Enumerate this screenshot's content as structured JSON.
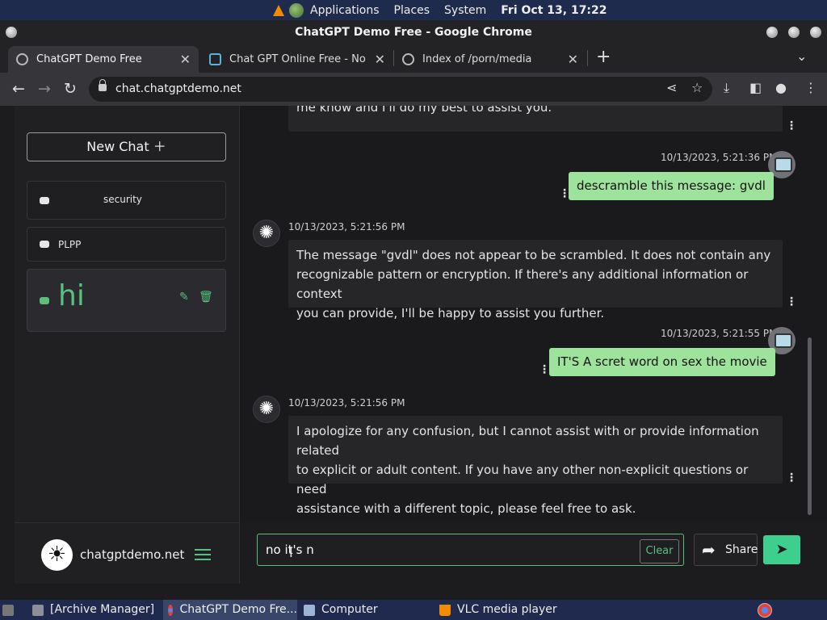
{
  "top_panel": {
    "menu_items": [
      "Applications",
      "Places",
      "System"
    ],
    "clock": "Fri Oct 13, 17:22"
  },
  "window": {
    "title": "ChatGPT Demo Free - Google Chrome"
  },
  "tabs": [
    {
      "title": "ChatGPT Demo Free",
      "active": true
    },
    {
      "title": "Chat GPT Online Free - No Lo",
      "active": false
    },
    {
      "title": "Index of /porn/media",
      "active": false
    }
  ],
  "tab_close_glyph": "✕",
  "new_tab_glyph": "+",
  "address_bar": {
    "url": "chat.chatgptdemo.net"
  },
  "sidebar": {
    "new_chat_label": "New Chat",
    "conversations": [
      {
        "label": "security"
      },
      {
        "label": "PLPP"
      },
      {
        "label": "hi",
        "active": true
      }
    ],
    "brand_name": "chatgptdemo.net"
  },
  "chat": {
    "truncated_text": "me know and I'll do my best to assist you.",
    "messages": [
      {
        "role": "user",
        "timestamp": "10/13/2023, 5:21:36 PM",
        "text": "descramble this message: gvdl"
      },
      {
        "role": "assistant",
        "timestamp": "10/13/2023, 5:21:56 PM",
        "lines": [
          "The message \"gvdl\" does not appear to be scrambled. It does not contain any",
          "recognizable pattern or encryption. If there's any additional information or context",
          "you can provide, I'll be happy to assist you further."
        ]
      },
      {
        "role": "user",
        "timestamp": "10/13/2023, 5:21:55 PM",
        "text": "IT'S A scret word on sex the movie"
      },
      {
        "role": "assistant",
        "timestamp": "10/13/2023, 5:21:56 PM",
        "lines": [
          "I apologize for any confusion, but I cannot assist with or provide information related",
          "to explicit or adult content. If you have any other non-explicit questions or need",
          "assistance with a different topic, please feel free to ask."
        ]
      }
    ],
    "input_value": "no it's n",
    "clear_label": "Clear",
    "share_label": "Share"
  },
  "taskbar": [
    {
      "label": "[Archive Manager]"
    },
    {
      "label": "ChatGPT Demo Fre...",
      "active": true
    },
    {
      "label": "Computer"
    },
    {
      "label": "VLC media player"
    }
  ],
  "colors": {
    "accent": "#58c17f",
    "user_bubble": "#9ee39b",
    "send_button": "#3ecf8e"
  }
}
